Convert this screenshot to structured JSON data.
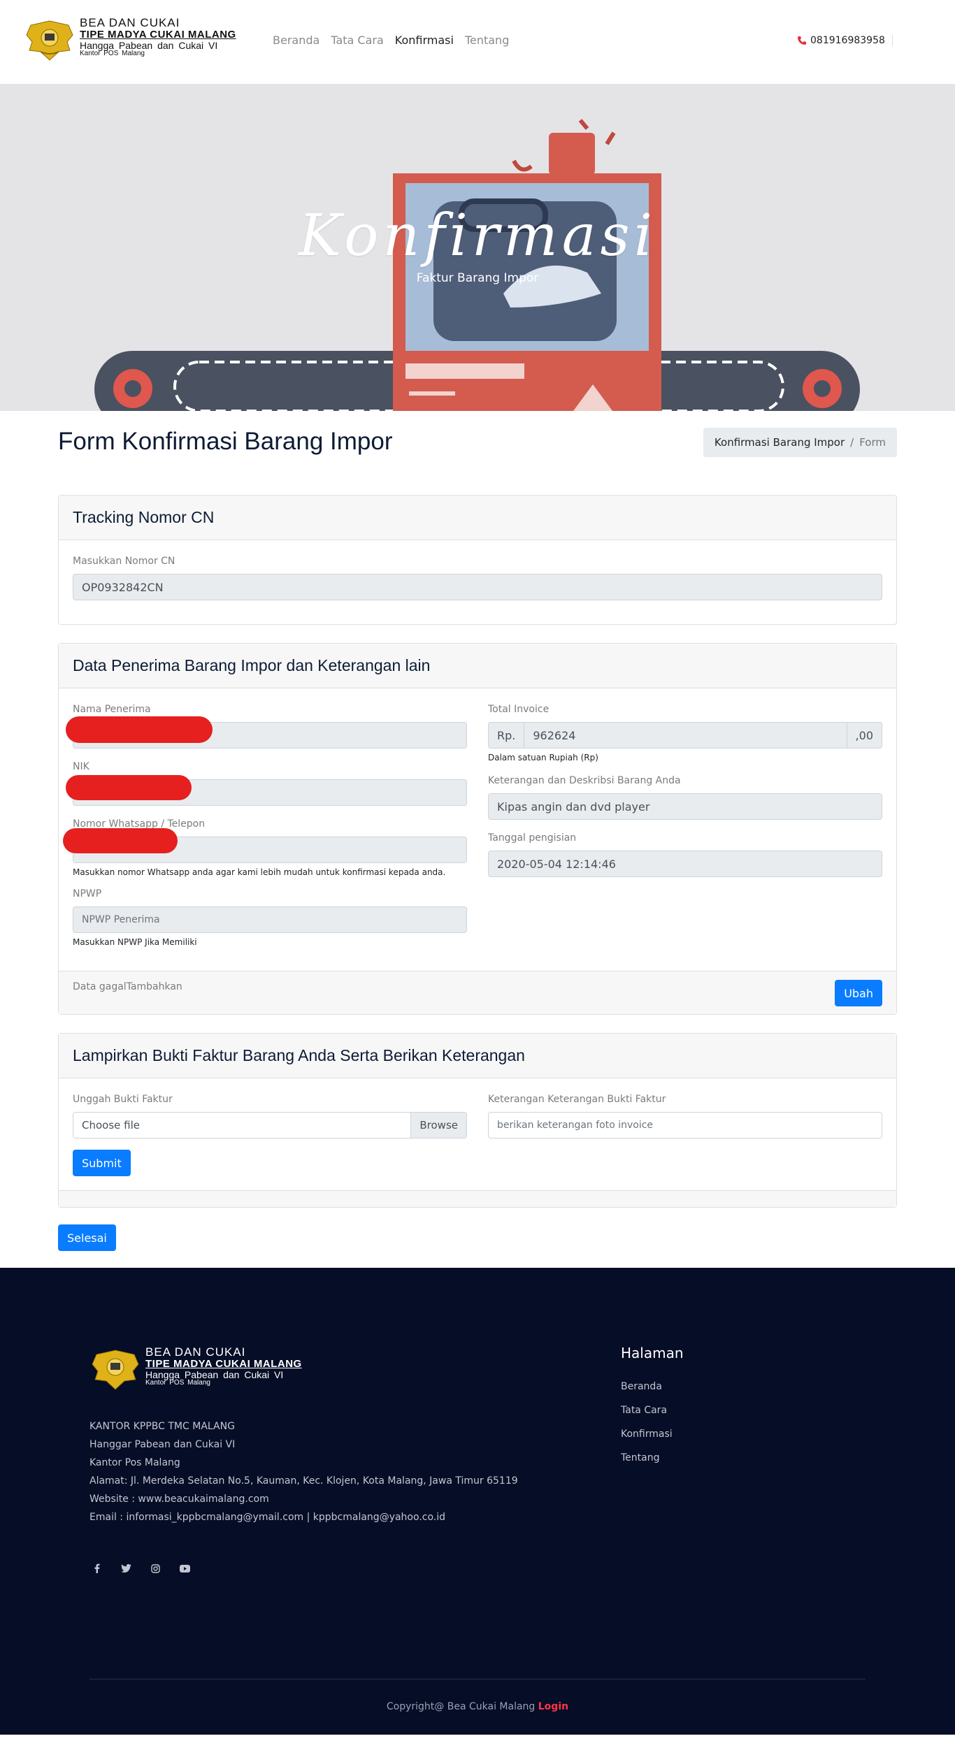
{
  "brand": {
    "line1": "BEA  DAN  CUKAI",
    "line2": "TIPE  MADYA  CUKAI  MALANG",
    "line3": "Hangga  Pabean  dan  Cukai  VI",
    "line4": "Kantor  POS  Malang"
  },
  "nav": {
    "items": [
      {
        "label": "Beranda",
        "active": false
      },
      {
        "label": "Tata Cara",
        "active": false
      },
      {
        "label": "Konfirmasi",
        "active": true
      },
      {
        "label": "Tentang",
        "active": false
      }
    ],
    "phone": "081916983958"
  },
  "hero": {
    "title": "Konfirmasi",
    "subtitle": "Faktur Barang Impor"
  },
  "page": {
    "title": "Form Konfirmasi Barang Impor",
    "breadcrumb": [
      "Konfirmasi Barang Impor",
      "Form"
    ]
  },
  "tracking": {
    "header": "Tracking Nomor CN",
    "label": "Masukkan Nomor CN",
    "value": "OP0932842CN"
  },
  "recipient": {
    "header": "Data Penerima Barang Impor dan Keterangan lain",
    "name_label": "Nama Penerima",
    "nik_label": "NIK",
    "phone_label": "Nomor Whatsapp / Telepon",
    "phone_help": "Masukkan nomor Whatsapp anda agar kami lebih mudah untuk konfirmasi kepada anda.",
    "npwp_label": "NPWP",
    "npwp_placeholder": "NPWP Penerima",
    "npwp_help": "Masukkan NPWP Jika Memiliki",
    "invoice_label": "Total Invoice",
    "invoice_prefix": "Rp.",
    "invoice_value": "962624",
    "invoice_suffix": ",00",
    "invoice_help": "Dalam satuan Rupiah (Rp)",
    "desc_label": "Keterangan dan Deskribsi Barang Anda",
    "desc_value": "Kipas angin dan dvd player",
    "date_label": "Tanggal pengisian",
    "date_value": "2020-05-04 12:14:46",
    "footer_text": "Data gagalTambahkan",
    "edit_button": "Ubah"
  },
  "attachment": {
    "header": "Lampirkan Bukti Faktur Barang Anda Serta Berikan Keterangan",
    "upload_label": "Unggah Bukti Faktur",
    "file_placeholder": "Choose file",
    "browse": "Browse",
    "note_label": "Keterangan Keterangan Bukti Faktur",
    "note_placeholder": "berikan keterangan foto invoice",
    "submit": "Submit"
  },
  "done_button": "Selesai",
  "footer": {
    "info": [
      "KANTOR KPPBC TMC MALANG",
      "Hanggar Pabean dan Cukai VI",
      "Kantor Pos Malang",
      "Alamat: Jl. Merdeka Selatan No.5, Kauman, Kec. Klojen, Kota Malang, Jawa Timur 65119",
      "Website : www.beacukaimalang.com",
      "Email : informasi_kppbcmalang@ymail.com | kppbcmalang@yahoo.co.id"
    ],
    "links_title": "Halaman",
    "links": [
      "Beranda",
      "Tata Cara",
      "Konfirmasi",
      "Tentang"
    ],
    "copyright": "Copyright@ Bea Cukai Malang",
    "login": "Login",
    "social_icons": [
      "facebook-icon",
      "twitter-icon",
      "instagram-icon",
      "youtube-icon"
    ]
  },
  "colors": {
    "primary": "#0a7cff",
    "footer_bg": "#060d26",
    "accent_red": "#ff3547",
    "hero_bg": "#e4e4e6"
  }
}
